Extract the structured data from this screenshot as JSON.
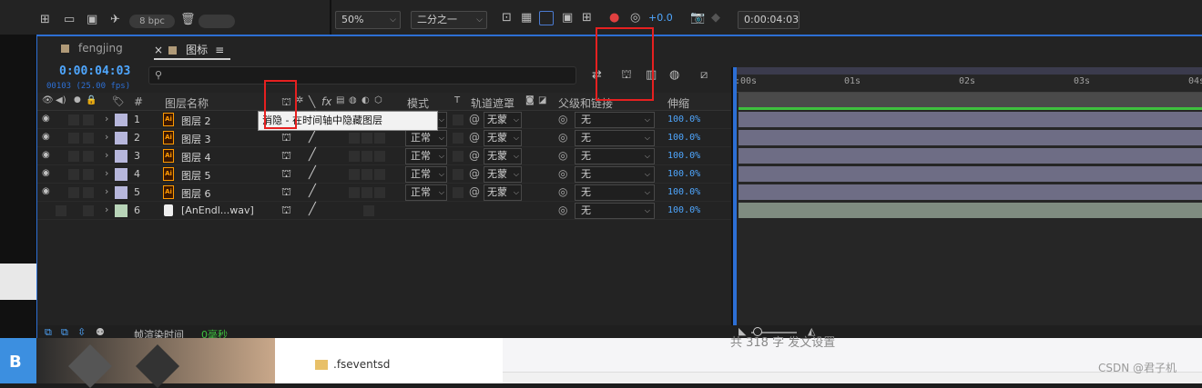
{
  "toolbar": {
    "bpc_label": "8 bpc",
    "zoom_value": "50%",
    "resolution_value": "二分之一",
    "exposure_value": "+0.0",
    "timecode_value": "0:00:04:03"
  },
  "tabs": [
    {
      "label": "fengjing",
      "active": false
    },
    {
      "label": "图标",
      "active": true
    }
  ],
  "tab_close_glyph": "×",
  "tab_menu_glyph": "≡",
  "comp": {
    "timecode": "0:00:04:03",
    "frames_fps": "00103 (25.00 fps)"
  },
  "search": {
    "placeholder": ""
  },
  "columns": {
    "hash": "#",
    "layer_name": "图层名称",
    "mode": "模式",
    "t": "T",
    "track_matte": "轨道遮罩",
    "parent_link": "父级和链接",
    "stretch": "伸缩"
  },
  "tooltip": "消隐 - 在时间轴中隐藏图层",
  "layers": [
    {
      "index": "1",
      "name": "图层 2",
      "type": "ai",
      "color": "#b7b7dc",
      "mode": "正常",
      "matte": "无蒙",
      "parent": "无",
      "stretch": "100.0%"
    },
    {
      "index": "2",
      "name": "图层 3",
      "type": "ai",
      "color": "#b7b7dc",
      "mode": "正常",
      "matte": "无蒙",
      "parent": "无",
      "stretch": "100.0%"
    },
    {
      "index": "3",
      "name": "图层 4",
      "type": "ai",
      "color": "#b7b7dc",
      "mode": "正常",
      "matte": "无蒙",
      "parent": "无",
      "stretch": "100.0%"
    },
    {
      "index": "4",
      "name": "图层 5",
      "type": "ai",
      "color": "#b7b7dc",
      "mode": "正常",
      "matte": "无蒙",
      "parent": "无",
      "stretch": "100.0%"
    },
    {
      "index": "5",
      "name": "图层 6",
      "type": "ai",
      "color": "#b7b7dc",
      "mode": "正常",
      "matte": "无蒙",
      "parent": "无",
      "stretch": "100.0%"
    },
    {
      "index": "6",
      "name": "[AnEndl...wav]",
      "type": "audio",
      "color": "#b8d4b8",
      "mode": "",
      "matte": "",
      "parent": "无",
      "stretch": "100.0%"
    }
  ],
  "ai_badge": "Ai",
  "timeline": {
    "ticks": [
      ":00s",
      "01s",
      "02s",
      "03s",
      "04s"
    ]
  },
  "status": {
    "render_label": "帧渲染时间",
    "render_value": "0毫秒"
  },
  "desktop": {
    "folder_label": ".fseventsd",
    "bg_text": "共 318 字    发文设置",
    "watermark": "CSDN @君子机"
  }
}
